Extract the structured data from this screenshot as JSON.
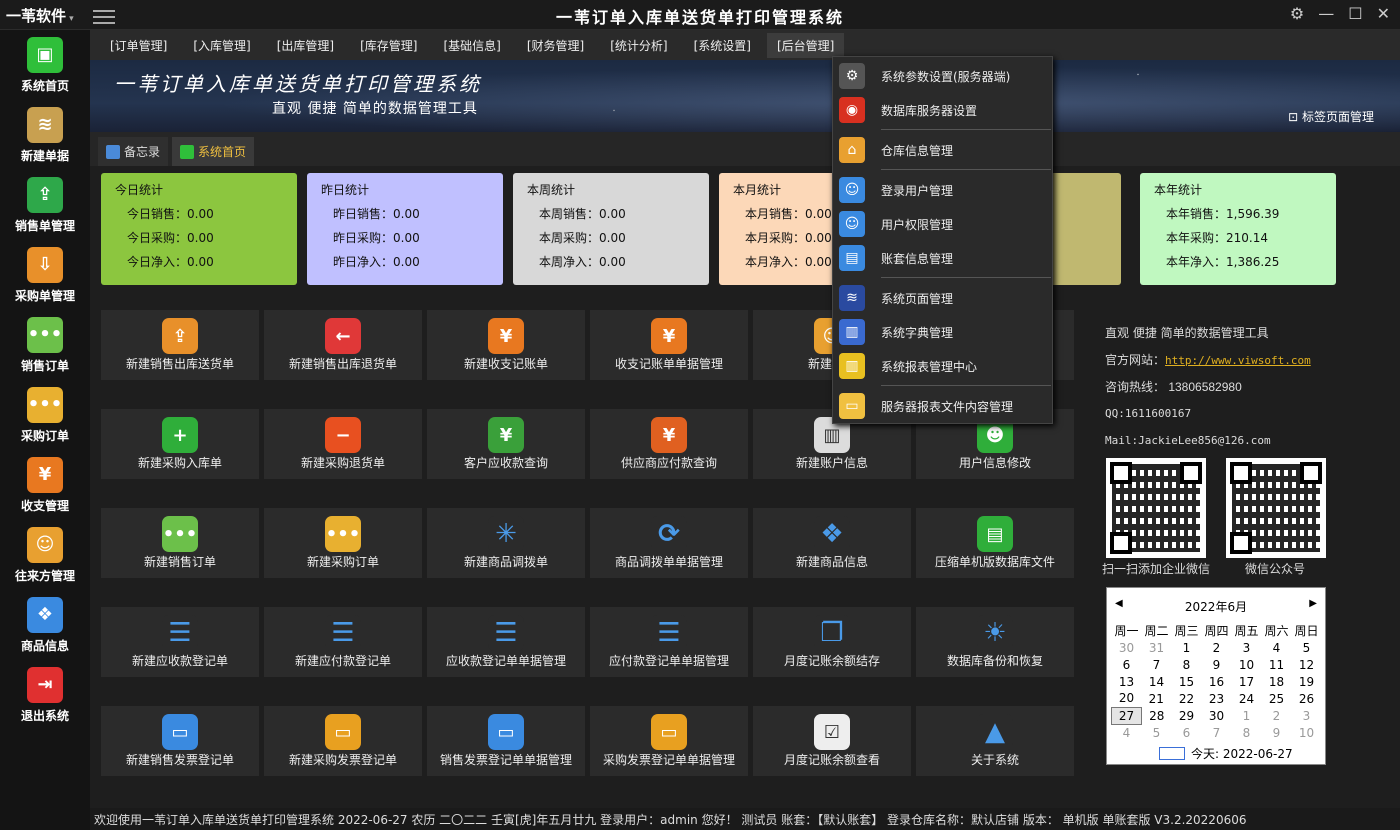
{
  "app": {
    "brand": "一苇软件",
    "title": "一苇订单入库单送货单打印管理系统"
  },
  "sidebar": [
    {
      "label": "系统首页",
      "icon": "cube-icon",
      "color": "#2fbf3a"
    },
    {
      "label": "新建单据",
      "icon": "layers-add-icon",
      "color": "#c8a050"
    },
    {
      "label": "销售单管理",
      "icon": "box-out-icon",
      "color": "#2ea84a"
    },
    {
      "label": "采购单管理",
      "icon": "box-in-icon",
      "color": "#e8902a"
    },
    {
      "label": "销售订单",
      "icon": "chat-dots-icon",
      "color": "#6cc04a"
    },
    {
      "label": "采购订单",
      "icon": "chat-dots-icon",
      "color": "#e8b030"
    },
    {
      "label": "收支管理",
      "icon": "yen-icon",
      "color": "#e87820"
    },
    {
      "label": "往来方管理",
      "icon": "user-icon",
      "color": "#e8a030"
    },
    {
      "label": "商品信息",
      "icon": "cubes-icon",
      "color": "#3a8ae0"
    },
    {
      "label": "退出系统",
      "icon": "exit-icon",
      "color": "#e03030"
    }
  ],
  "menu": [
    "[订单管理]",
    "[入库管理]",
    "[出库管理]",
    "[库存管理]",
    "[基础信息]",
    "[财务管理]",
    "[统计分析]",
    "[系统设置]",
    "[后台管理]"
  ],
  "banner": {
    "title": "一苇订单入库单送货单打印管理系统",
    "subtitle": "直观  便捷  简单的数据管理工具",
    "tab_manager": "标签页面管理"
  },
  "tabs": [
    {
      "label": "备忘录",
      "color": "#4a8ad8"
    },
    {
      "label": "系统首页",
      "color": "#2fbf3a"
    }
  ],
  "stats": [
    {
      "title": "今日统计",
      "color": "#8cc63f",
      "lines": [
        "今日销售：0.00",
        "今日采购：0.00",
        "今日净入：0.00"
      ]
    },
    {
      "title": "昨日统计",
      "color": "#c0c0ff",
      "lines": [
        "昨日销售：0.00",
        "昨日采购：0.00",
        "昨日净入：0.00"
      ]
    },
    {
      "title": "本周统计",
      "color": "#d8d8d8",
      "lines": [
        "本周销售：0.00",
        "本周采购：0.00",
        "本周净入：0.00"
      ]
    },
    {
      "title": "本月统计",
      "color": "#fcd8b8",
      "lines": [
        "本月销售：0.00",
        "本月采购：0.00",
        "本月净入：0.00"
      ]
    },
    {
      "title": "",
      "color": "#c0b870",
      "lines": [
        "",
        "",
        ""
      ]
    },
    {
      "title": "本年统计",
      "color": "#c0f8c0",
      "lines": [
        "本年销售：1,596.39",
        "本年采购：210.14",
        "本年净入：1,386.25"
      ]
    }
  ],
  "tiles": [
    {
      "label": "新建销售出库送货单",
      "icon": "box-out-icon",
      "color": "#e8902a"
    },
    {
      "label": "新建销售出库退货单",
      "icon": "arrow-left-icon",
      "color": "#e03838"
    },
    {
      "label": "新建收支记账单",
      "icon": "yen-icon",
      "color": "#e87820"
    },
    {
      "label": "收支记账单单据管理",
      "icon": "yen-icon",
      "color": "#e87820"
    },
    {
      "label": "新建往来",
      "icon": "user-icon",
      "color": "#e8a030"
    },
    {
      "label": "",
      "icon": "",
      "color": "#2b2b2b"
    },
    {
      "label": "新建采购入库单",
      "icon": "plus-icon",
      "color": "#2fae3a"
    },
    {
      "label": "新建采购退货单",
      "icon": "minus-icon",
      "color": "#e85020"
    },
    {
      "label": "客户应收款查询",
      "icon": "receipt-yen-icon",
      "color": "#3aa03a"
    },
    {
      "label": "供应商应付款查询",
      "icon": "receipt-yen-icon",
      "color": "#e06020"
    },
    {
      "label": "新建账户信息",
      "icon": "barcode-receipt-icon",
      "color": "#dcdcdc"
    },
    {
      "label": "用户信息修改",
      "icon": "users-icon",
      "color": "#2fae3a"
    },
    {
      "label": "新建销售订单",
      "icon": "chat-dots-icon",
      "color": "#6cc04a"
    },
    {
      "label": "新建采购订单",
      "icon": "chat-dots-icon",
      "color": "#e8b030"
    },
    {
      "label": "新建商品调拨单",
      "icon": "network-icon",
      "color": "#2b2b2b"
    },
    {
      "label": "商品调拨单单据管理",
      "icon": "refresh-icon",
      "color": "#2b2b2b"
    },
    {
      "label": "新建商品信息",
      "icon": "cubes-icon",
      "color": "#2b2b2b"
    },
    {
      "label": "压缩单机版数据库文件",
      "icon": "archive-icon",
      "color": "#2fae3a"
    },
    {
      "label": "新建应收款登记单",
      "icon": "list-in-icon",
      "color": "#2b2b2b"
    },
    {
      "label": "新建应付款登记单",
      "icon": "list-out-icon",
      "color": "#2b2b2b"
    },
    {
      "label": "应收款登记单单据管理",
      "icon": "list-in-icon",
      "color": "#2b2b2b"
    },
    {
      "label": "应付款登记单单据管理",
      "icon": "list-out-icon",
      "color": "#2b2b2b"
    },
    {
      "label": "月度记账余额结存",
      "icon": "doc-copy-icon",
      "color": "#2b2b2b"
    },
    {
      "label": "数据库备份和恢复",
      "icon": "sun-cloud-icon",
      "color": "#2b2b2b"
    },
    {
      "label": "新建销售发票登记单",
      "icon": "doc-icon",
      "color": "#3a8ae0"
    },
    {
      "label": "新建采购发票登记单",
      "icon": "doc-icon",
      "color": "#e8a020"
    },
    {
      "label": "销售发票登记单单据管理",
      "icon": "doc-icon",
      "color": "#3a8ae0"
    },
    {
      "label": "采购发票登记单单据管理",
      "icon": "doc-icon",
      "color": "#e8a020"
    },
    {
      "label": "月度记账余额查看",
      "icon": "checklist-icon",
      "color": "#eeeeee"
    },
    {
      "label": "关于系统",
      "icon": "triangle-icon",
      "color": "#2b2b2b"
    }
  ],
  "info": {
    "tagline": "直观  便捷  简单的数据管理工具",
    "website_label": "官方网站：",
    "website": "http://www.viwsoft.com",
    "hotline": "咨询热线： 13806582980",
    "qq": "QQ:1611600167",
    "mail": "Mail:JackieLee856@126.com",
    "qr1_label": "扫一扫添加企业微信",
    "qr2_label": "微信公众号"
  },
  "calendar": {
    "month": "2022年6月",
    "weekdays": [
      "周一",
      "周二",
      "周三",
      "周四",
      "周五",
      "周六",
      "周日"
    ],
    "rows": [
      [
        "30",
        "31",
        "1",
        "2",
        "3",
        "4",
        "5"
      ],
      [
        "6",
        "7",
        "8",
        "9",
        "10",
        "11",
        "12"
      ],
      [
        "13",
        "14",
        "15",
        "16",
        "17",
        "18",
        "19"
      ],
      [
        "20",
        "21",
        "22",
        "23",
        "24",
        "25",
        "26"
      ],
      [
        "27",
        "28",
        "29",
        "30",
        "1",
        "2",
        "3"
      ],
      [
        "4",
        "5",
        "6",
        "7",
        "8",
        "9",
        "10"
      ]
    ],
    "today_label": "今天: 2022-06-27"
  },
  "dropdown": [
    {
      "label": "系统参数设置(服务器端)",
      "icon": "gear-icon",
      "color": "#555555"
    },
    {
      "label": "数据库服务器设置",
      "icon": "database-icon",
      "color": "#d83020"
    },
    {
      "label": "仓库信息管理",
      "icon": "store-icon",
      "color": "#e8a030"
    },
    {
      "label": "登录用户管理",
      "icon": "user-add-icon",
      "color": "#3a8ae0"
    },
    {
      "label": "用户权限管理",
      "icon": "user-gear-icon",
      "color": "#3a8ae0"
    },
    {
      "label": "账套信息管理",
      "icon": "drawer-icon",
      "color": "#3a8ae0"
    },
    {
      "label": "系统页面管理",
      "icon": "layers-icon",
      "color": "#2a4aa0"
    },
    {
      "label": "系统字典管理",
      "icon": "books-icon",
      "color": "#3a6ad0"
    },
    {
      "label": "系统报表管理中心",
      "icon": "binders-icon",
      "color": "#e8c020"
    },
    {
      "label": "服务器报表文件内容管理",
      "icon": "folder-icon",
      "color": "#f0c040"
    }
  ],
  "status": "欢迎使用一苇订单入库单送货单打印管理系统 2022-06-27 农历 二〇二二 壬寅[虎]年五月廿九 登录用户：admin 您好！ 测试员 账套：【默认账套】 登录仓库名称：默认店铺 版本：   单机版 单账套版 V3.2.20220606"
}
